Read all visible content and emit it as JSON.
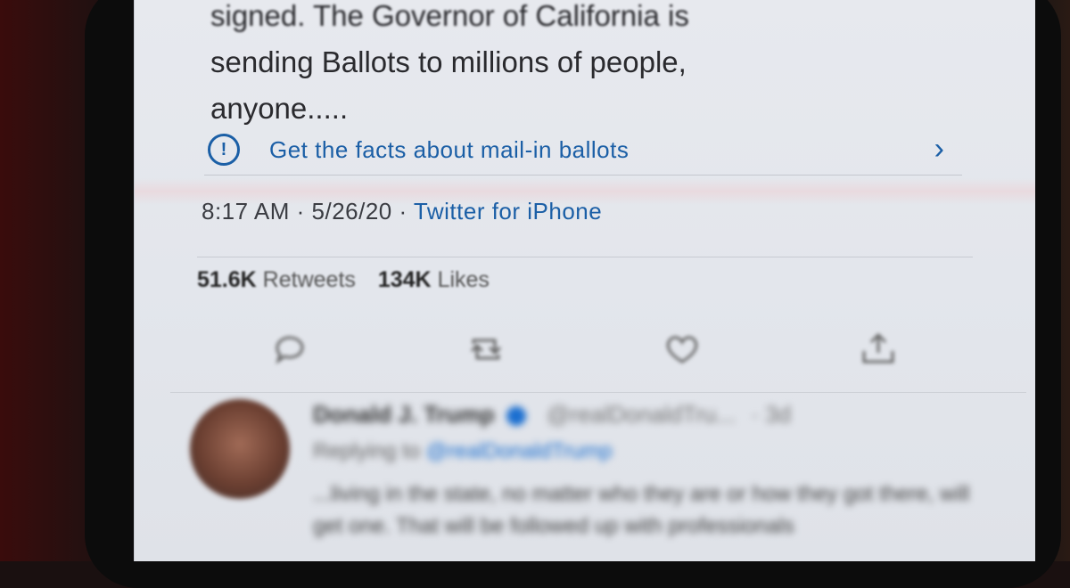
{
  "tweet": {
    "text_lines": [
      "signed. The Governor of California is",
      "sending Ballots to millions of people,",
      "anyone....."
    ]
  },
  "notice": {
    "icon": "exclamation-circle-icon",
    "icon_glyph": "!",
    "label": "Get the facts about mail-in ballots",
    "chevron": "›"
  },
  "meta": {
    "time": "8:17 AM",
    "sep1": " · ",
    "date": "5/26/20",
    "sep2": " · ",
    "source": "Twitter for iPhone"
  },
  "stats": {
    "retweets_count": "51.6K",
    "retweets_label": "Retweets",
    "likes_count": "134K",
    "likes_label": "Likes"
  },
  "actions": [
    "reply-icon",
    "retweet-icon",
    "like-icon",
    "share-icon"
  ],
  "reply_tweet": {
    "author": "Donald J. Trump",
    "handle": "@realDonaldTru...",
    "age": "· 3d",
    "replying_label": "Replying to",
    "replying_to": "@realDonaldTrump",
    "body": "...living in the state, no matter who they are or how they got there, will get one. That will be followed up with professionals"
  },
  "colors": {
    "link_blue": "#1b5fa6",
    "screen_bg": "#e5e8ed",
    "text": "#2a2a2e"
  }
}
